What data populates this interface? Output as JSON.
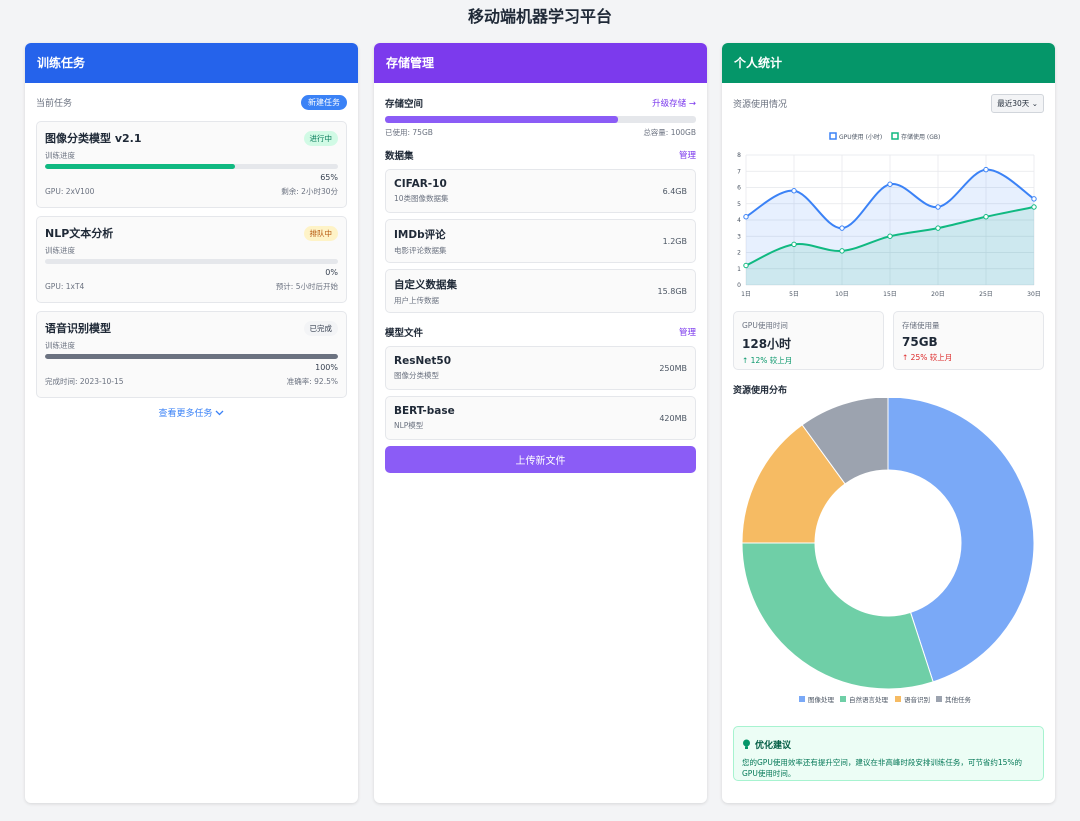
{
  "page_title": "移动端机器学习平台",
  "training": {
    "header": "训练任务",
    "current_label": "当前任务",
    "new_button": "新建任务",
    "progress_label": "训练进度",
    "tasks": [
      {
        "title": "图像分类模型 v2.1",
        "status": "进行中",
        "progress": 65,
        "progress_text": "65%",
        "left": "GPU: 2xV100",
        "right": "剩余: 2小时30分",
        "color": "#10b981"
      },
      {
        "title": "NLP文本分析",
        "status": "排队中",
        "progress": 0,
        "progress_text": "0%",
        "left": "GPU: 1xT4",
        "right": "预计: 5小时后开始",
        "color": "#10b981"
      },
      {
        "title": "语音识别模型",
        "status": "已完成",
        "progress": 100,
        "progress_text": "100%",
        "left": "完成时间: 2023-10-15",
        "right": "准确率: 92.5%",
        "color": "#6b7280"
      }
    ],
    "more_link": "查看更多任务"
  },
  "storage": {
    "header": "存储管理",
    "space_title": "存储空间",
    "upgrade_link": "升级存储 →",
    "used_fraction": 0.75,
    "used_text": "已使用: 75GB",
    "total_text": "总容量: 100GB",
    "datasets_title": "数据集",
    "manage_label": "管理",
    "datasets": [
      {
        "name": "CIFAR-10",
        "desc": "10类图像数据集",
        "size": "6.4GB"
      },
      {
        "name": "IMDb评论",
        "desc": "电影评论数据集",
        "size": "1.2GB"
      },
      {
        "name": "自定义数据集",
        "desc": "用户上传数据",
        "size": "15.8GB"
      }
    ],
    "models_title": "模型文件",
    "models": [
      {
        "name": "ResNet50",
        "desc": "图像分类模型",
        "size": "250MB"
      },
      {
        "name": "BERT-base",
        "desc": "NLP模型",
        "size": "420MB"
      }
    ],
    "upload_button": "上传新文件"
  },
  "stats": {
    "header": "个人统计",
    "usage_title": "资源使用情况",
    "range_select": "最近30天",
    "gpu_card": {
      "label": "GPU使用时间",
      "value": "128小时",
      "change": "↑ 12% 较上月"
    },
    "storage_card": {
      "label": "存储使用量",
      "value": "75GB",
      "change": "↑ 25% 较上月"
    },
    "dist_title": "资源使用分布",
    "tip_title": "优化建议",
    "tip_text": "您的GPU使用效率还有提升空间，建议在非高峰时段安排训练任务，可节省约15%的GPU使用时间。"
  },
  "chart_data": [
    {
      "type": "line",
      "x": [
        "1日",
        "5日",
        "10日",
        "15日",
        "20日",
        "25日",
        "30日"
      ],
      "ylim": [
        0,
        8
      ],
      "yticks": [
        "0",
        "1",
        "2",
        "3",
        "4",
        "5",
        "6",
        "7",
        "8"
      ],
      "grid": true,
      "legend": "top",
      "series": [
        {
          "name": "GPU使用 (小时)",
          "values": [
            4.2,
            5.8,
            3.5,
            6.2,
            4.8,
            7.1,
            5.3
          ],
          "color": "#3b82f6"
        },
        {
          "name": "存储使用 (GB)",
          "values": [
            1.2,
            2.5,
            2.1,
            3.0,
            3.5,
            4.2,
            4.8
          ],
          "color": "#10b981"
        }
      ]
    },
    {
      "type": "pie",
      "donut": true,
      "legend": "bottom",
      "categories": [
        "图像处理",
        "自然语言处理",
        "语音识别",
        "其他任务"
      ],
      "values": [
        45,
        30,
        15,
        10
      ],
      "colors": [
        "#7aa9f7",
        "#6fcfa7",
        "#f6bb63",
        "#9ca3af"
      ]
    }
  ]
}
